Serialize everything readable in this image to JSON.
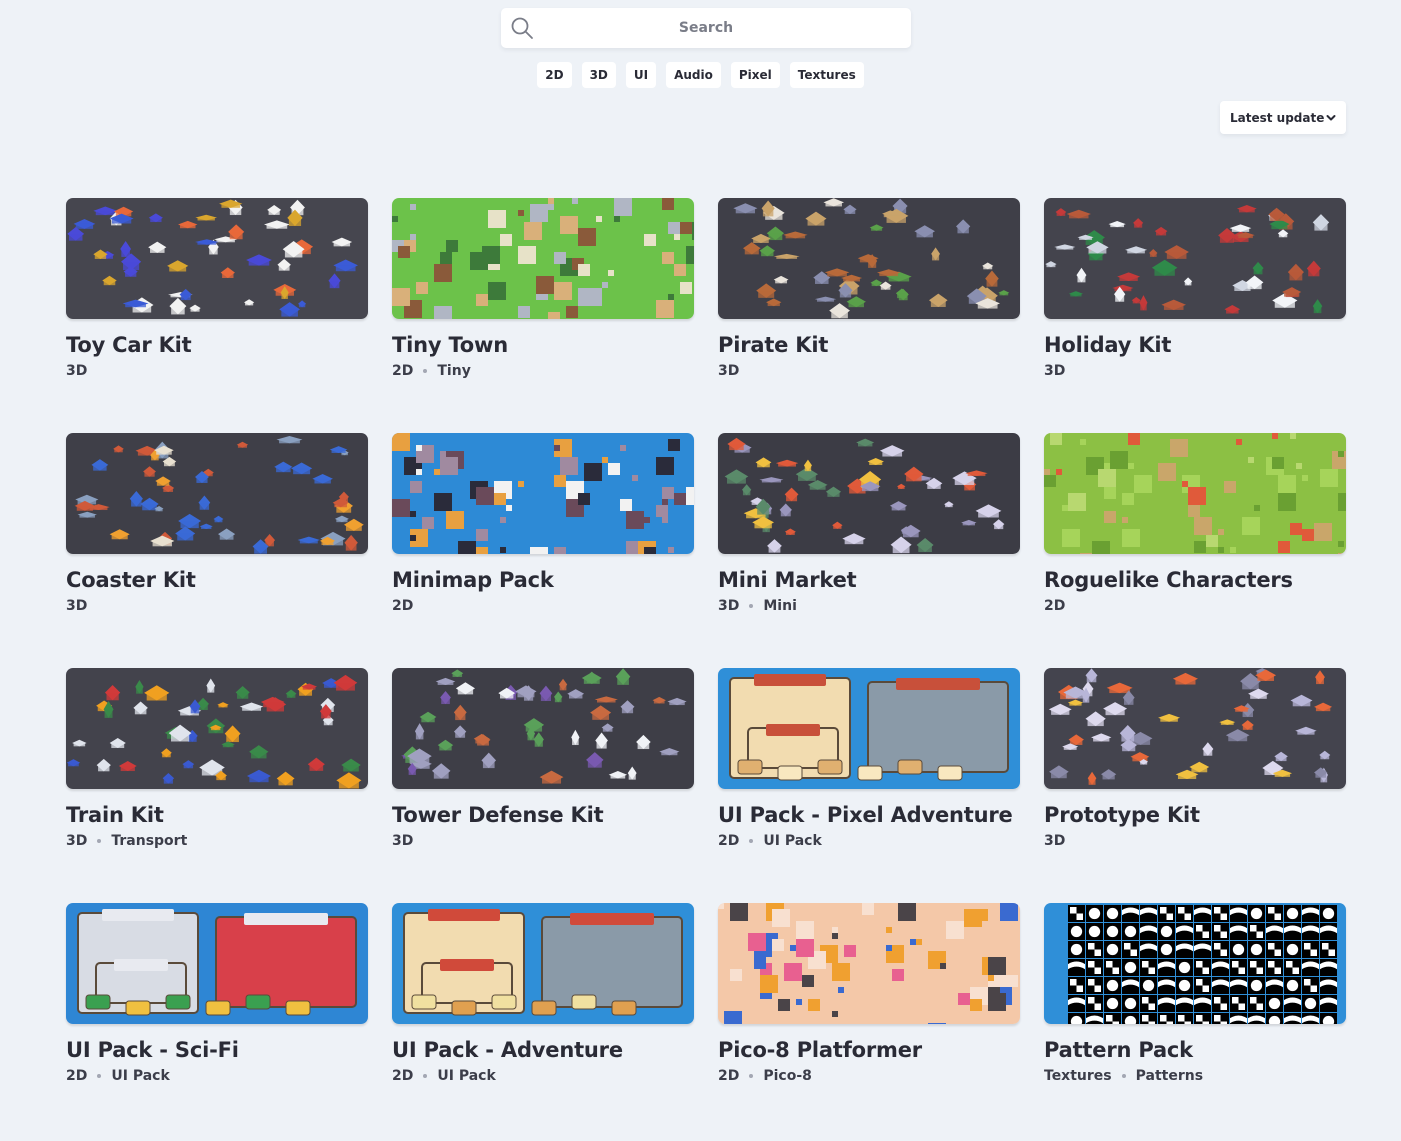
{
  "search": {
    "placeholder": "Search",
    "icon": "search-icon"
  },
  "filters": [
    "2D",
    "3D",
    "UI",
    "Audio",
    "Pixel",
    "Textures"
  ],
  "sort": {
    "label": "Latest update",
    "icon": "chevron-down-icon"
  },
  "assets": [
    {
      "title": "Toy Car Kit",
      "tags": [
        "3D"
      ],
      "theme": "toycar"
    },
    {
      "title": "Tiny Town",
      "tags": [
        "2D",
        "Tiny"
      ],
      "theme": "tinytown"
    },
    {
      "title": "Pirate Kit",
      "tags": [
        "3D"
      ],
      "theme": "pirate"
    },
    {
      "title": "Holiday Kit",
      "tags": [
        "3D"
      ],
      "theme": "holiday"
    },
    {
      "title": "Coaster Kit",
      "tags": [
        "3D"
      ],
      "theme": "coaster"
    },
    {
      "title": "Minimap Pack",
      "tags": [
        "2D"
      ],
      "theme": "minimap"
    },
    {
      "title": "Mini Market",
      "tags": [
        "3D",
        "Mini"
      ],
      "theme": "market"
    },
    {
      "title": "Roguelike Characters",
      "tags": [
        "2D"
      ],
      "theme": "roguelike"
    },
    {
      "title": "Train Kit",
      "tags": [
        "3D",
        "Transport"
      ],
      "theme": "train"
    },
    {
      "title": "Tower Defense Kit",
      "tags": [
        "3D"
      ],
      "theme": "tower"
    },
    {
      "title": "UI Pack - Pixel Adventure",
      "tags": [
        "2D",
        "UI Pack"
      ],
      "theme": "uipixel"
    },
    {
      "title": "Prototype Kit",
      "tags": [
        "3D"
      ],
      "theme": "prototype"
    },
    {
      "title": "UI Pack - Sci-Fi",
      "tags": [
        "2D",
        "UI Pack"
      ],
      "theme": "uiscifi"
    },
    {
      "title": "UI Pack - Adventure",
      "tags": [
        "2D",
        "UI Pack"
      ],
      "theme": "uiadventure"
    },
    {
      "title": "Pico-8 Platformer",
      "tags": [
        "2D",
        "Pico-8"
      ],
      "theme": "pico"
    },
    {
      "title": "Pattern Pack",
      "tags": [
        "Textures",
        "Patterns"
      ],
      "theme": "pattern"
    }
  ]
}
